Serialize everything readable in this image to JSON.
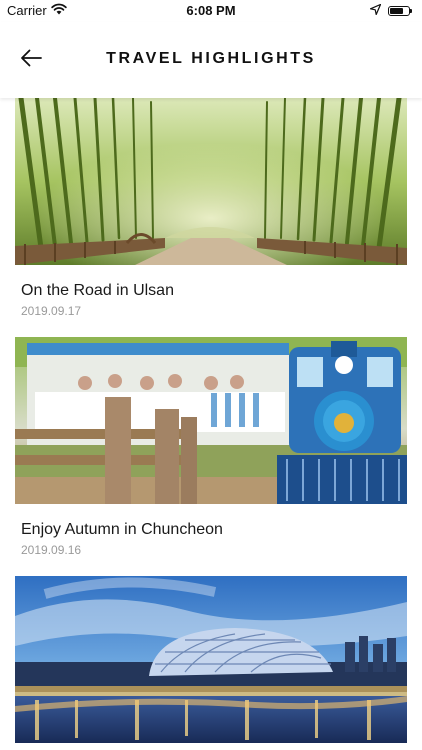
{
  "status_bar": {
    "carrier": "Carrier",
    "time": "6:08 PM",
    "battery_level": 0.7,
    "icons": [
      "wifi-icon",
      "location-arrow-icon",
      "battery-icon"
    ]
  },
  "header": {
    "title": "TRAVEL HIGHLIGHTS",
    "back_icon": "arrow-left-icon"
  },
  "posts": [
    {
      "title": "On the Road in Ulsan",
      "date": "2019.09.17",
      "image": "bamboo-forest-path"
    },
    {
      "title": "Enjoy Autumn in Chuncheon",
      "date": "2019.09.16",
      "image": "park-train"
    },
    {
      "title": "",
      "date": "",
      "image": "night-skyline-dome"
    }
  ],
  "colors": {
    "text": "#111111",
    "date": "#9a9a9a",
    "background": "#ffffff"
  }
}
